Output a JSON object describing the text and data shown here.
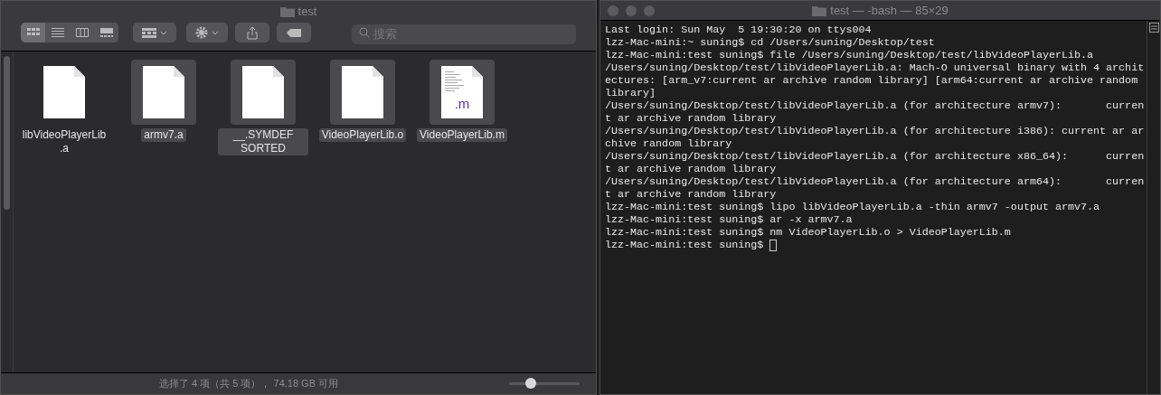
{
  "finder": {
    "title": "test",
    "view_buttons": [
      {
        "kind": "icons",
        "selected": true
      },
      {
        "kind": "list",
        "selected": false
      },
      {
        "kind": "columns",
        "selected": false
      },
      {
        "kind": "gallery",
        "selected": false
      }
    ],
    "search": {
      "placeholder": "搜索"
    },
    "files": [
      {
        "name": "libVideoPlayerLib.a",
        "kind": "blank",
        "selected": false
      },
      {
        "name": "armv7.a",
        "kind": "blank",
        "selected": true
      },
      {
        "name": "__.SYMDEF SORTED",
        "kind": "blank",
        "selected": true
      },
      {
        "name": "VideoPlayerLib.o",
        "kind": "blank",
        "selected": true
      },
      {
        "name": "VideoPlayerLib.m",
        "kind": "source",
        "badge": ".m",
        "selected": true
      }
    ],
    "status_bar": {
      "text": "选择了 4 项（共 5 项）， 74.18 GB 可用",
      "zoom": {
        "level": 0.27
      }
    }
  },
  "terminal": {
    "title": "test — -bash — 85×29",
    "lines": [
      "Last login: Sun May  5 19:30:20 on ttys004",
      "lzz-Mac-mini:~ suning$ cd /Users/suning/Desktop/test",
      "lzz-Mac-mini:test suning$ file /Users/suning/Desktop/test/libVideoPlayerLib.a",
      "/Users/suning/Desktop/test/libVideoPlayerLib.a: Mach-O universal binary with 4 archit",
      "ectures: [arm_v7:current ar archive random library] [arm64:current ar archive random",
      "library]",
      "/Users/suning/Desktop/test/libVideoPlayerLib.a (for architecture armv7):       curren",
      "t ar archive random library",
      "/Users/suning/Desktop/test/libVideoPlayerLib.a (for architecture i386): current ar ar",
      "chive random library",
      "/Users/suning/Desktop/test/libVideoPlayerLib.a (for architecture x86_64):      curren",
      "t ar archive random library",
      "/Users/suning/Desktop/test/libVideoPlayerLib.a (for architecture arm64):       curren",
      "t ar archive random library",
      "lzz-Mac-mini:test suning$ lipo libVideoPlayerLib.a -thin armv7 -output armv7.a",
      "lzz-Mac-mini:test suning$ ar -x armv7.a",
      "lzz-Mac-mini:test suning$ nm VideoPlayerLib.o > VideoPlayerLib.m",
      "lzz-Mac-mini:test suning$ "
    ],
    "cursor": true
  }
}
